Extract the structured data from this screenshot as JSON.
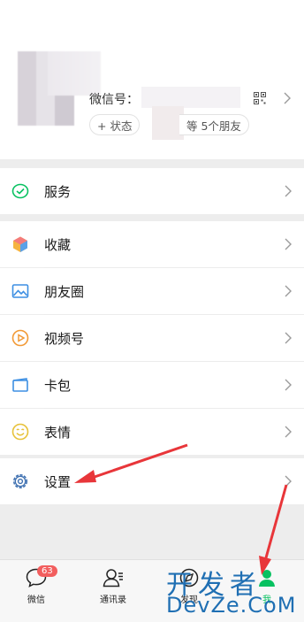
{
  "profile": {
    "wxid_label": "微信号：",
    "status_label": "+ 状态",
    "friends_label": "等 5个朋友"
  },
  "menu": [
    {
      "id": "service",
      "label": "服务",
      "icon": "service-icon"
    },
    {
      "id": "favorites",
      "label": "收藏",
      "icon": "favorites-icon"
    },
    {
      "id": "moments",
      "label": "朋友圈",
      "icon": "moments-icon"
    },
    {
      "id": "channels",
      "label": "视频号",
      "icon": "channels-icon"
    },
    {
      "id": "cards",
      "label": "卡包",
      "icon": "card-wallet-icon"
    },
    {
      "id": "stickers",
      "label": "表情",
      "icon": "sticker-icon"
    },
    {
      "id": "settings",
      "label": "设置",
      "icon": "gear-icon"
    }
  ],
  "tabbar": {
    "chats": {
      "label": "微信",
      "badge": "63"
    },
    "contacts": {
      "label": "通讯录"
    },
    "discover": {
      "label": "发现"
    },
    "me": {
      "label": "我"
    }
  },
  "watermark": {
    "top": "开发者",
    "bottom": "DevZe.CoM"
  },
  "colors": {
    "accent_green": "#07c160",
    "badge_red": "#f25e5e",
    "annotation_red": "#e8363a",
    "watermark_blue": "#1f6fb3"
  }
}
